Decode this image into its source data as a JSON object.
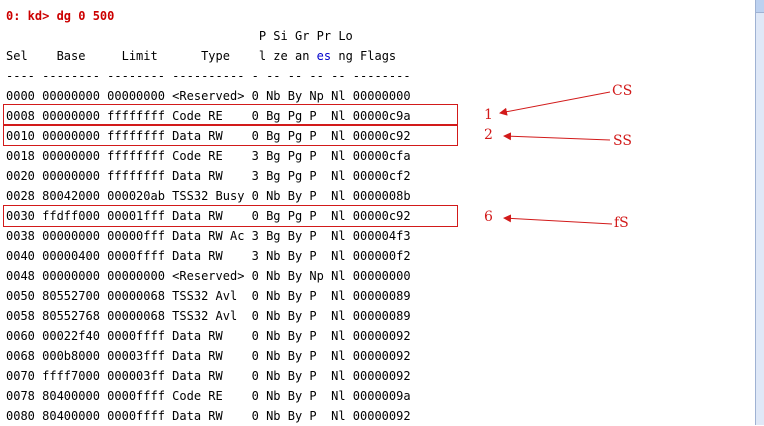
{
  "prompt": "0: kd> dg 0 500",
  "header": {
    "line1": "                                   P Si Gr Pr Lo",
    "line2_prefix": "Sel    Base     Limit      Type    l ze an ",
    "line2_es": "es",
    "line2_suffix": " ng Flags",
    "line3": "---- -------- -------- ---------- - -- -- -- -- --------"
  },
  "rows": [
    "0000 00000000 00000000 <Reserved> 0 Nb By Np Nl 00000000",
    "0008 00000000 ffffffff Code RE    0 Bg Pg P  Nl 00000c9a",
    "0010 00000000 ffffffff Data RW    0 Bg Pg P  Nl 00000c92",
    "0018 00000000 ffffffff Code RE    3 Bg Pg P  Nl 00000cfa",
    "0020 00000000 ffffffff Data RW    3 Bg Pg P  Nl 00000cf2",
    "0028 80042000 000020ab TSS32 Busy 0 Nb By P  Nl 0000008b",
    "0030 ffdff000 00001fff Data RW    0 Bg Pg P  Nl 00000c92",
    "0038 00000000 00000fff Data RW Ac 3 Bg By P  Nl 000004f3",
    "0040 00000400 0000ffff Data RW    3 Nb By P  Nl 000000f2",
    "0048 00000000 00000000 <Reserved> 0 Nb By Np Nl 00000000",
    "0050 80552700 00000068 TSS32 Avl  0 Nb By P  Nl 00000089",
    "0058 80552768 00000068 TSS32 Avl  0 Nb By P  Nl 00000089",
    "0060 00022f40 0000ffff Data RW    0 Nb By P  Nl 00000092",
    "0068 000b8000 00003fff Data RW    0 Nb By P  Nl 00000092",
    "0070 ffff7000 000003ff Data RW    0 Nb By P  Nl 00000092",
    "0078 80400000 0000ffff Code RE    0 Nb By P  Nl 0000009a",
    "0080 80400000 0000ffff Data RW    0 Nb By P  Nl 00000092"
  ],
  "annotations": {
    "num1": "1",
    "num2": "2",
    "num6": "6",
    "cs": "CS",
    "ss": "SS",
    "fs": "fS"
  },
  "colors": {
    "prompt": "#cc0000",
    "annotation": "#d21a1a",
    "es": "#0000cc"
  }
}
